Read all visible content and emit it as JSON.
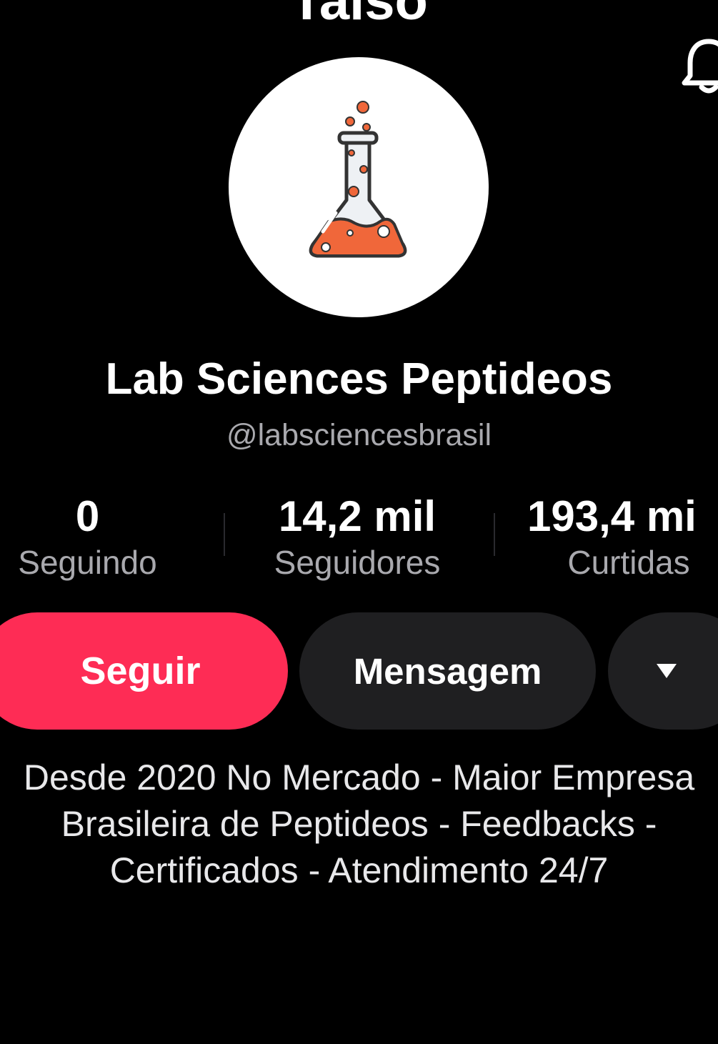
{
  "header": {
    "title": "Taiso",
    "notification_icon": "bell-icon"
  },
  "profile": {
    "avatar_icon": "flask-icon",
    "display_name": "Lab Sciences Peptideos",
    "handle": "@labsciencesbrasil"
  },
  "stats": {
    "following": {
      "value": "0",
      "label": "Seguindo"
    },
    "followers": {
      "value": "14,2 mil",
      "label": "Seguidores"
    },
    "likes": {
      "value": "193,4 mi",
      "label": "Curtidas"
    }
  },
  "actions": {
    "follow_label": "Seguir",
    "message_label": "Mensagem",
    "more_icon": "caret-down-icon"
  },
  "bio": {
    "lines": [
      "Desde 2020 No Mercado - Maior Empresa",
      "Brasileira de Peptideos - Feedbacks -",
      "Certificados - Atendimento 24/7"
    ]
  },
  "colors": {
    "background": "#000000",
    "follow_button": "#fe2c55",
    "secondary_button": "#1f1f21",
    "muted_text": "#a9a9ae",
    "flask_liquid": "#f0673a"
  }
}
